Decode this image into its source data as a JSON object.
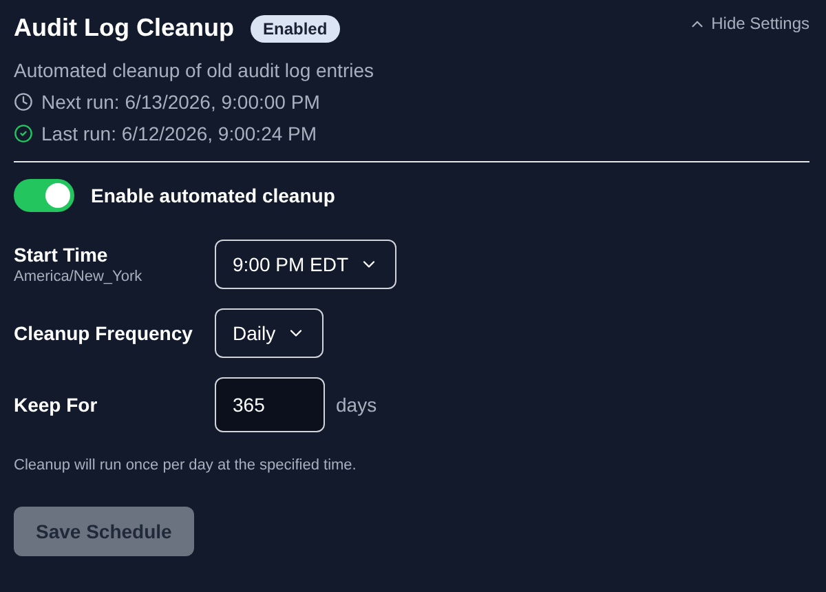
{
  "header": {
    "title": "Audit Log Cleanup",
    "badge": "Enabled",
    "toggle_link": "Hide Settings"
  },
  "description": "Automated cleanup of old audit log entries",
  "runs": [
    {
      "kind": "next",
      "text": "Next run: 6/13/2026, 9:00:00 PM"
    },
    {
      "kind": "last",
      "text": "Last run: 6/12/2026, 9:00:24 PM"
    }
  ],
  "enable": {
    "label": "Enable automated cleanup",
    "on": true
  },
  "fields": [
    {
      "kind": "select",
      "label": "Start Time",
      "sublabel": "America/New_York",
      "value": "9:00 PM EDT"
    },
    {
      "kind": "select",
      "label": "Cleanup Frequency",
      "value": "Daily"
    },
    {
      "kind": "input",
      "label": "Keep For",
      "value": "365",
      "unit": "days"
    }
  ],
  "hint": "Cleanup will run once per day at the specified time.",
  "save_button": {
    "label": "Save Schedule",
    "disabled": true
  }
}
